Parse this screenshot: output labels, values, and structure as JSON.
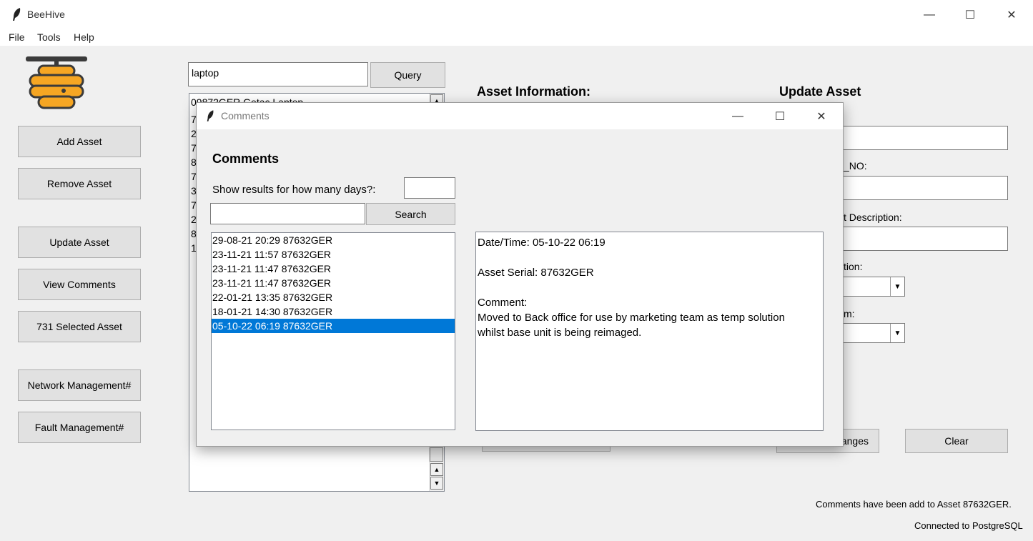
{
  "window": {
    "title": "BeeHive",
    "controls": {
      "minimize": "—",
      "maximize": "☐",
      "close": "✕"
    }
  },
  "menu": [
    "File",
    "Tools",
    "Help"
  ],
  "sidebar": {
    "buttons": [
      "Add Asset",
      "Remove Asset",
      "Update Asset",
      "View Comments",
      "731 Selected Asset",
      "Network Management#",
      "Fault Management#"
    ]
  },
  "search": {
    "query_value": "laptop",
    "query_button": "Query",
    "results_visible": [
      "09872GER Getac Laptop",
      "7",
      "2",
      "7",
      "8",
      "7",
      "3",
      "7",
      "2",
      "8",
      "1"
    ]
  },
  "asset_info": {
    "heading": "Asset Information:"
  },
  "update_asset": {
    "heading": "Update Asset",
    "labels_visible": [
      "_NO:",
      "t Description:",
      "tion:",
      "m:"
    ],
    "save_button_visible": "anges",
    "clear_button": "Clear"
  },
  "status": {
    "message": "Comments have been add to Asset 87632GER.",
    "connection": "Connected to PostgreSQL"
  },
  "comments_dialog": {
    "title": "Comments",
    "heading": "Comments",
    "days_label": "Show results for how many days?:",
    "days_value": "",
    "search_value": "",
    "search_button": "Search",
    "entries": [
      "29-08-21 20:29 87632GER",
      "23-11-21 11:57 87632GER",
      "23-11-21 11:47 87632GER",
      "23-11-21 11:47 87632GER",
      "22-01-21 13:35 87632GER",
      "18-01-21 14:30 87632GER",
      "05-10-22 06:19 87632GER"
    ],
    "selected_index": 6,
    "detail": {
      "datetime": "Date/Time: 05-10-22 06:19",
      "serial": "Asset Serial: 87632GER",
      "comment_label": "Comment:",
      "comment_line1": "Moved to Back office for use by marketing team as temp solution",
      "comment_line2": "whilst base unit is being reimaged."
    }
  },
  "colors": {
    "selection": "#0078d7",
    "logo_orange": "#f6a623",
    "logo_dark": "#3b3b3b"
  }
}
